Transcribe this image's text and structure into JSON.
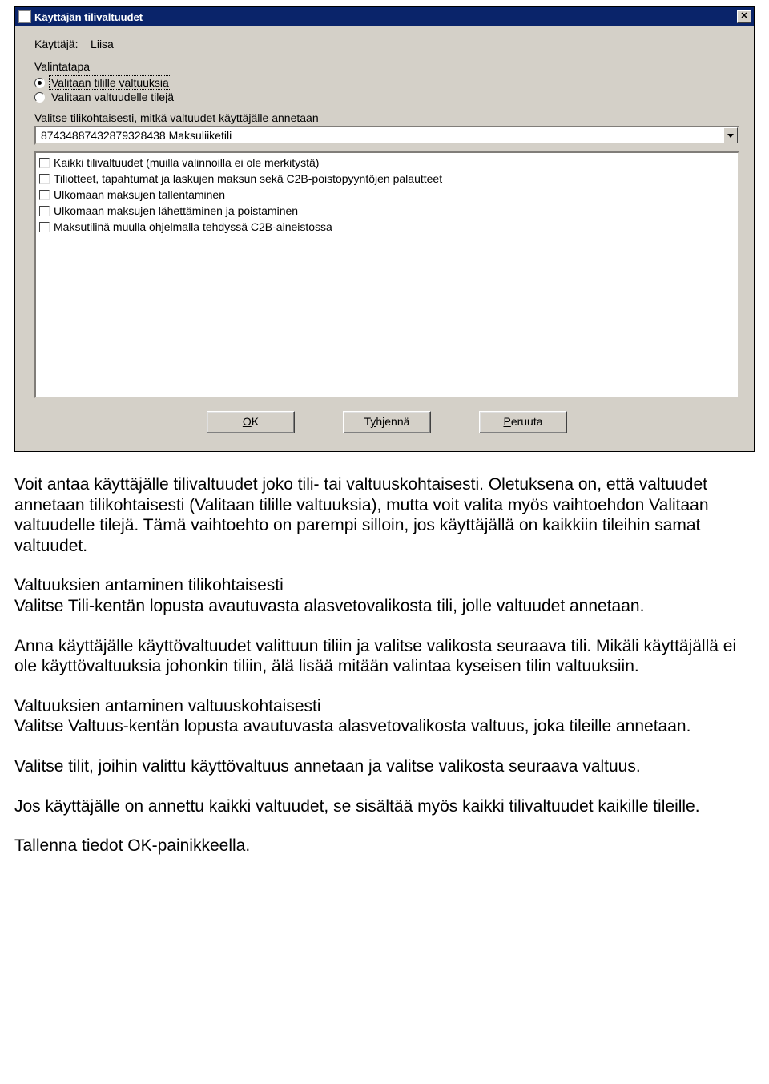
{
  "dialog": {
    "title": "Käyttäjän tilivaltuudet",
    "user_label": "Käyttäjä:",
    "user_name": "Liisa",
    "group_label": "Valintatapa",
    "radios": [
      {
        "label": "Valitaan tilille valtuuksia",
        "checked": true,
        "focused": true
      },
      {
        "label": "Valitaan valtuudelle tilejä",
        "checked": false,
        "focused": false
      }
    ],
    "instruction": "Valitse tilikohtaisesti, mitkä valtuudet käyttäjälle annetaan",
    "dropdown_value": "87434887432879328438  Maksuliiketili",
    "checklist": [
      "Kaikki tilivaltuudet (muilla valinnoilla ei ole merkitystä)",
      "Tiliotteet, tapahtumat ja laskujen maksun sekä C2B-poistopyyntöjen palautteet",
      "Ulkomaan maksujen tallentaminen",
      "Ulkomaan maksujen lähettäminen ja poistaminen",
      "Maksutilinä muulla ohjelmalla tehdyssä C2B-aineistossa"
    ],
    "buttons": {
      "ok_pre": "",
      "ok_u": "O",
      "ok_post": "K",
      "clear_pre": "T",
      "clear_u": "y",
      "clear_post": "hjennä",
      "cancel_pre": "",
      "cancel_u": "P",
      "cancel_post": "eruuta"
    }
  },
  "doc": {
    "p1": "Voit antaa käyttäjälle tilivaltuudet joko tili- tai valtuuskohtaisesti. Oletuksena on, että valtuudet annetaan tilikohtaisesti (Valitaan tilille valtuuksia), mutta voit valita myös vaihtoehdon Valitaan valtuudelle tilejä. Tämä vaihtoehto on parempi silloin, jos käyttäjällä on kaikkiin tileihin samat valtuudet.",
    "p2a": "Valtuuksien antaminen tilikohtaisesti",
    "p2b": "Valitse Tili-kentän lopusta avautuvasta alasvetovalikosta tili, jolle valtuudet annetaan.",
    "p3": "Anna käyttäjälle käyttövaltuudet valittuun tiliin ja valitse valikosta seuraava tili. Mikäli käyttäjällä ei ole käyttövaltuuksia johonkin tiliin, älä lisää mitään valintaa kyseisen tilin valtuuksiin.",
    "p4a": "Valtuuksien antaminen valtuuskohtaisesti",
    "p4b": "Valitse Valtuus-kentän lopusta avautuvasta alasvetovalikosta valtuus, joka tileille annetaan.",
    "p5": "Valitse tilit, joihin valittu käyttövaltuus annetaan ja valitse valikosta seuraava valtuus.",
    "p6": "Jos käyttäjälle on annettu kaikki valtuudet, se sisältää myös kaikki tilivaltuudet kaikille tileille.",
    "p7": "Tallenna tiedot OK-painikkeella."
  }
}
